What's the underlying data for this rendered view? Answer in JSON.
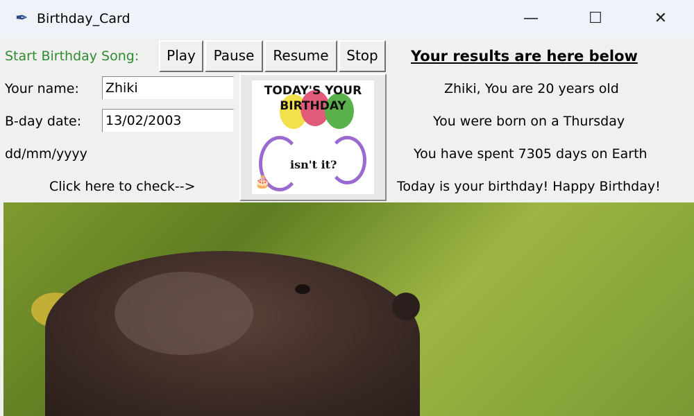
{
  "window": {
    "title": "Birthday_Card",
    "minimize": "—",
    "maximize": "☐",
    "close": "✕"
  },
  "song": {
    "label": "Start Birthday Song:",
    "play": "Play",
    "pause": "Pause",
    "resume": "Resume",
    "stop": "Stop"
  },
  "form": {
    "name_label": "Your name:",
    "name_value": "Zhiki",
    "date_label": "B-day date:",
    "date_value": "13/02/2003",
    "date_format": "dd/mm/yyyy",
    "check_label": "Click here to check-->"
  },
  "card": {
    "line1": "TODAY'S YOUR",
    "line2": "BIRTHDAY",
    "line3": "isn't it?"
  },
  "results": {
    "heading": "Your results are here below",
    "age": "Zhiki, You are 20 years old",
    "weekday": "You were born on a Thursday",
    "days": "You have spent 7305 days on Earth",
    "today": "Today is your birthday! Happy Birthday!"
  },
  "colors": {
    "song_label": "#2e8b2e"
  }
}
